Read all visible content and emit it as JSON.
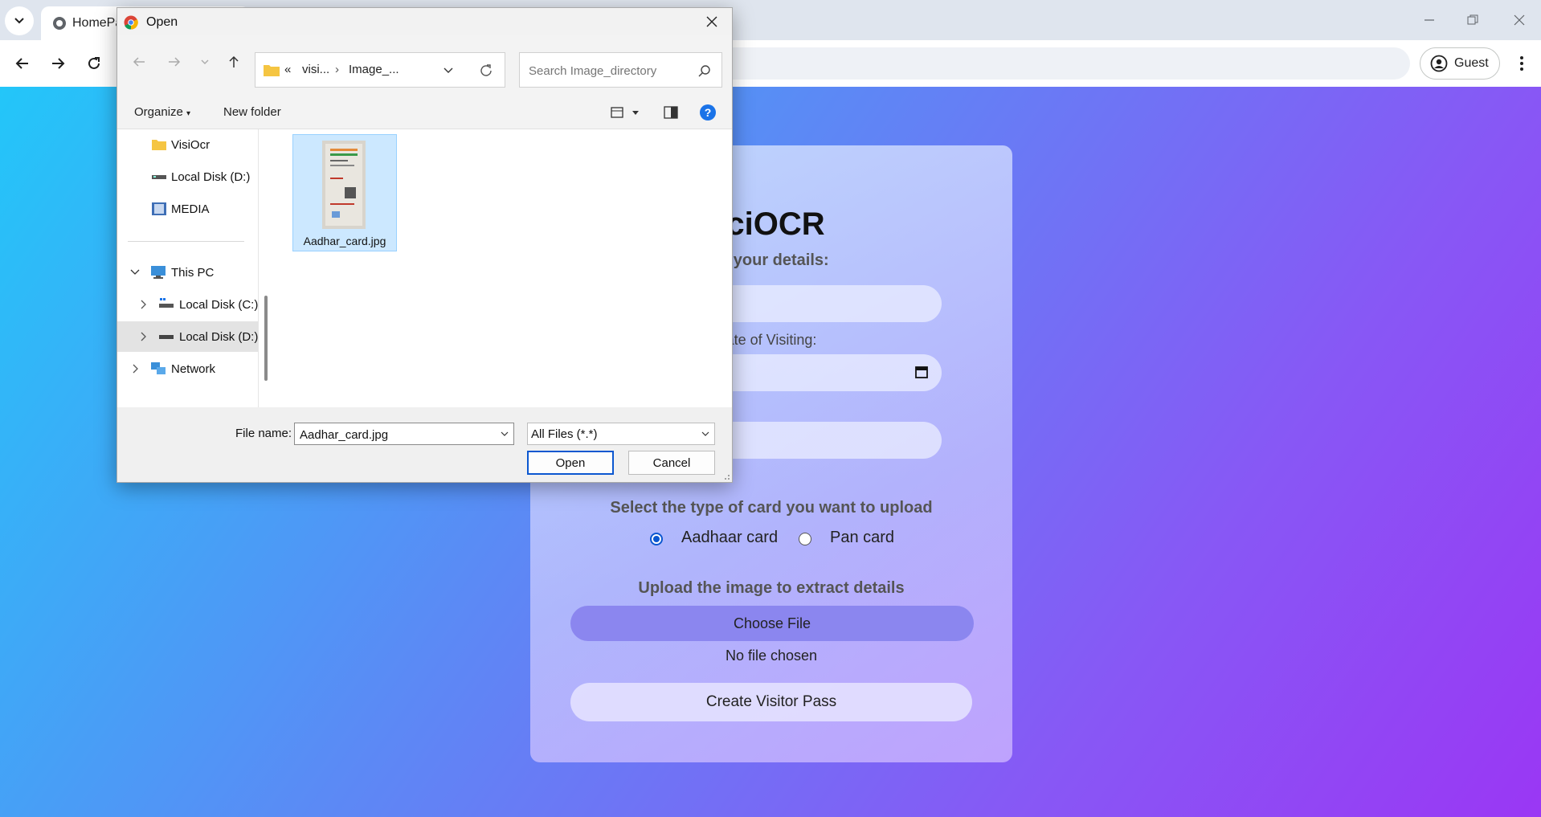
{
  "browser": {
    "tab_title": "HomePa",
    "profile_label": "Guest"
  },
  "page": {
    "app_title": "iciOCR",
    "subtitle": "er your details:",
    "date_label": "ate of Visiting:",
    "card_type_label": "Select the type of card you want to upload",
    "radio_options": [
      {
        "label": "Aadhaar card",
        "checked": true
      },
      {
        "label": "Pan card",
        "checked": false
      }
    ],
    "upload_label": "Upload the image to extract details",
    "choose_file_label": "Choose File",
    "no_file_label": "No file chosen",
    "create_pass_label": "Create Visitor Pass"
  },
  "dialog": {
    "title": "Open",
    "breadcrumb": [
      "visi...",
      "Image_..."
    ],
    "breadcrumb_prefix": "«",
    "search_placeholder": "Search Image_directory",
    "organize_label": "Organize",
    "new_folder_label": "New folder",
    "nav_items": [
      {
        "label": "VisiOcr",
        "icon": "folder-icon"
      },
      {
        "label": "Local Disk (D:)",
        "icon": "drive-icon"
      },
      {
        "label": "MEDIA",
        "icon": "media-library-icon"
      },
      {
        "label": "This PC",
        "icon": "computer-icon",
        "expanded": true
      },
      {
        "label": "Local Disk (C:)",
        "icon": "drive-icon"
      },
      {
        "label": "Local Disk (D:)",
        "icon": "drive-icon",
        "selected": true
      },
      {
        "label": "Network",
        "icon": "network-icon"
      }
    ],
    "files": [
      {
        "name": "Aadhar_card.jpg",
        "selected": true
      }
    ],
    "file_name_label": "File name:",
    "file_name_value": "Aadhar_card.jpg",
    "file_type_value": "All Files (*.*)",
    "open_label": "Open",
    "cancel_label": "Cancel"
  },
  "colors": {
    "accent": "#0b57d0",
    "gradient_start": "#23c6f9",
    "gradient_end": "#9a37f4",
    "choose_file_bg": "#8b86ef",
    "file_selected_bg": "#cce8ff"
  }
}
